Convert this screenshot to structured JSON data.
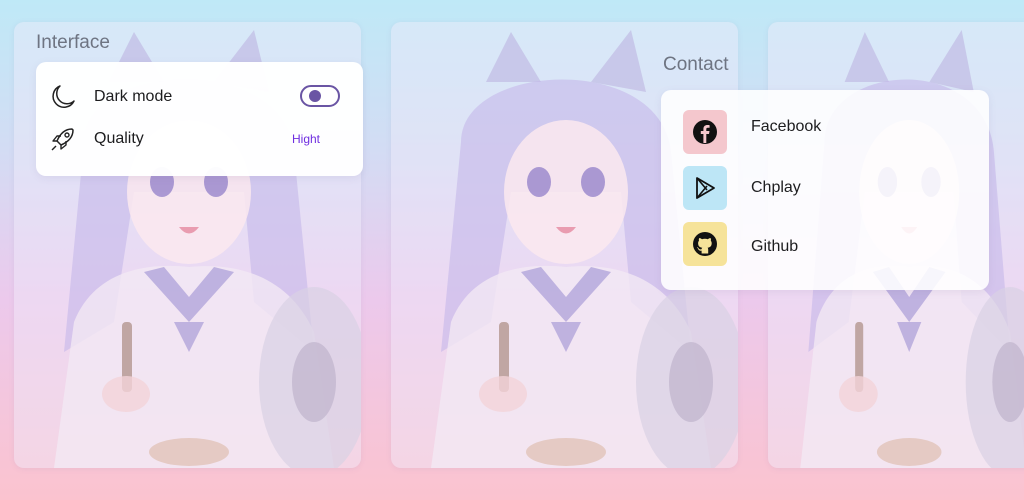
{
  "interface": {
    "heading": "Interface",
    "dark_mode_label": "Dark mode",
    "dark_mode_enabled": true,
    "quality_label": "Quality",
    "quality_value": "Hight"
  },
  "contact": {
    "heading": "Contact",
    "items": [
      {
        "label": "Facebook",
        "icon": "facebook-icon",
        "tile_color": "#f4c7cd"
      },
      {
        "label": "Chplay",
        "icon": "play-store-icon",
        "tile_color": "#bde6f6"
      },
      {
        "label": "Github",
        "icon": "github-icon",
        "tile_color": "#f6e39a"
      }
    ]
  },
  "colors": {
    "accent": "#6a55a4",
    "link": "#6f2ee0",
    "heading": "#6e7482"
  }
}
